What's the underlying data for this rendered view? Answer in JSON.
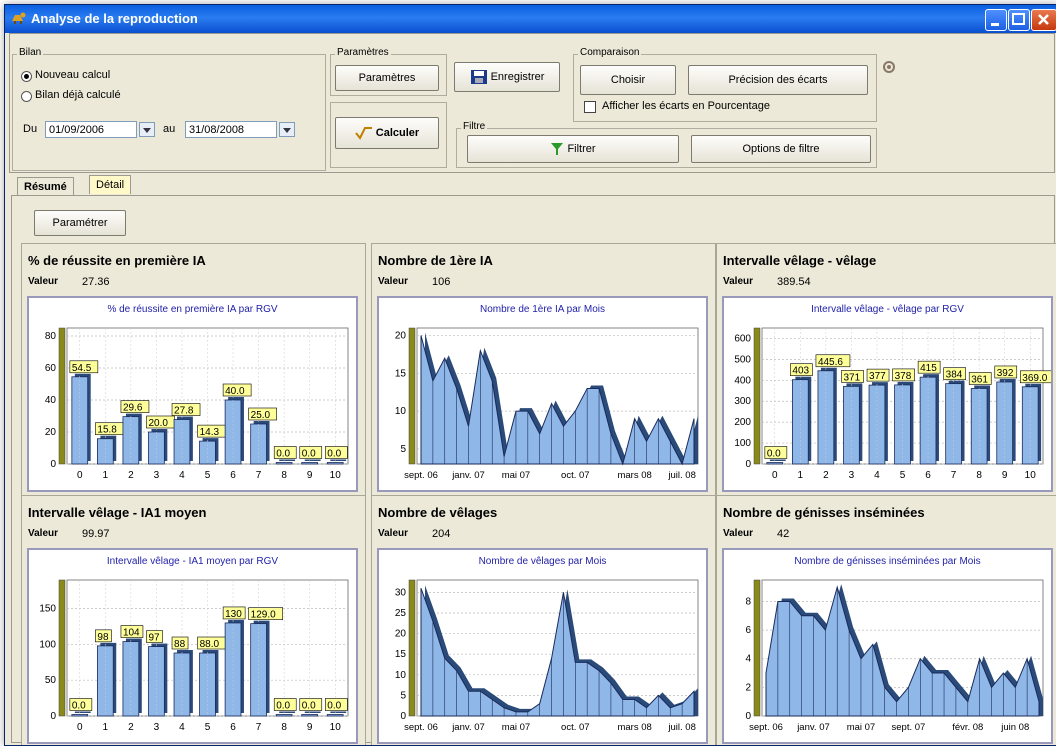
{
  "window": {
    "title": "Analyse de la reproduction"
  },
  "bilan": {
    "legend": "Bilan",
    "opt1": "Nouveau calcul",
    "opt2": "Bilan déjà calculé",
    "du_label": "Du",
    "du_value": "01/09/2006",
    "au_label": "au",
    "au_value": "31/08/2008"
  },
  "params": {
    "legend": "Paramètres",
    "button": "Paramètres"
  },
  "enregistrer": "Enregistrer",
  "calculer": "Calculer",
  "comparaison": {
    "legend": "Comparaison",
    "choisir": "Choisir",
    "precision": "Précision des écarts",
    "checkbox": "Afficher les écarts en Pourcentage"
  },
  "filtre": {
    "legend": "Filtre",
    "filtrer": "Filtrer",
    "options": "Options de filtre"
  },
  "tabs": [
    "Résumé",
    "Détail"
  ],
  "parametrer": "Paramétrer",
  "value_label": "Valeur",
  "cards": [
    {
      "title": "% de réussite en première IA",
      "value": "27.36"
    },
    {
      "title": "Nombre de 1ère IA",
      "value": "106"
    },
    {
      "title": "Intervalle vêlage - vêlage",
      "value": "389.54"
    },
    {
      "title": "Intervalle vêlage - IA1 moyen",
      "value": "99.97"
    },
    {
      "title": "Nombre de vêlages",
      "value": "204"
    },
    {
      "title": "Nombre de génisses inséminées",
      "value": "42"
    }
  ],
  "chart_data": [
    {
      "type": "bar",
      "title": "% de réussite en première IA par RGV",
      "categories": [
        "0",
        "1",
        "2",
        "3",
        "4",
        "5",
        "6",
        "7",
        "8",
        "9",
        "10"
      ],
      "values": [
        54.5,
        15.8,
        29.6,
        20.0,
        27.8,
        14.3,
        40.0,
        25.0,
        0.0,
        0.0,
        0.0
      ],
      "labels": [
        "54.5",
        "15.8",
        "29.6",
        "20.0",
        "27.8",
        "14.3",
        "40.0",
        "25.0",
        "0.0",
        "0.0",
        "0.0"
      ],
      "yticks": [
        "0",
        "20",
        "40",
        "60",
        "80"
      ],
      "ylim": [
        0,
        85
      ],
      "grid": true,
      "bar_color": "#8fb8e8"
    },
    {
      "type": "area",
      "title": "Nombre de 1ère IA par Mois",
      "x": [
        "sept. 06",
        "oct. 06",
        "nov. 06",
        "déc. 06",
        "janv. 07",
        "févr. 07",
        "mars 07",
        "avr. 07",
        "mai 07",
        "juin 07",
        "juil. 07",
        "août 07",
        "sept. 07",
        "oct. 07",
        "nov. 07",
        "déc. 07",
        "janv. 08",
        "févr. 08",
        "mars 08",
        "avr. 08",
        "mai 08",
        "juin 08",
        "juil. 08",
        "août 08"
      ],
      "values": [
        20,
        14,
        17,
        13,
        8,
        18,
        14,
        4,
        10,
        10,
        7,
        11,
        8,
        10,
        13,
        13,
        7,
        3,
        9,
        6,
        9,
        6,
        3,
        9
      ],
      "xticks": [
        "sept. 06",
        "janv. 07",
        "mai 07",
        "oct. 07",
        "mars 08",
        "juil. 08"
      ],
      "yticks": [
        "5",
        "10",
        "15",
        "20"
      ],
      "ylim": [
        3,
        21
      ],
      "grid": true
    },
    {
      "type": "bar",
      "title": "Intervalle vêlage - vêlage par RGV",
      "categories": [
        "0",
        "1",
        "2",
        "3",
        "4",
        "5",
        "6",
        "7",
        "8",
        "9",
        "10"
      ],
      "values": [
        0.0,
        403.0,
        445.6,
        371.0,
        377.0,
        378.0,
        415.0,
        384.0,
        361.0,
        392.0,
        369.0
      ],
      "labels": [
        "0.0",
        "403",
        "445.6",
        "371",
        "377",
        "378",
        "415",
        "384",
        "361",
        "392",
        "369.0"
      ],
      "yticks": [
        "0",
        "100",
        "200",
        "300",
        "400",
        "500",
        "600"
      ],
      "ylim": [
        0,
        650
      ],
      "grid": true,
      "bar_color": "#8fb8e8"
    },
    {
      "type": "bar",
      "title": "Intervalle vêlage - IA1 moyen par RGV",
      "categories": [
        "0",
        "1",
        "2",
        "3",
        "4",
        "5",
        "6",
        "7",
        "8",
        "9",
        "10"
      ],
      "values": [
        0.0,
        98.0,
        104.0,
        97.0,
        88.0,
        88.0,
        130.0,
        129.0,
        0.0,
        0.0,
        0.0
      ],
      "labels": [
        "0.0",
        "98",
        "104",
        "97",
        "88",
        "88.0",
        "130",
        "129.0",
        "0.0",
        "0.0",
        "0.0"
      ],
      "yticks": [
        "0",
        "50",
        "100",
        "150"
      ],
      "ylim": [
        0,
        190
      ],
      "grid": true,
      "bar_color": "#8fb8e8"
    },
    {
      "type": "area",
      "title": "Nombre de vêlages par Mois",
      "x": [
        "sept. 06",
        "oct. 06",
        "nov. 06",
        "déc. 06",
        "janv. 07",
        "févr. 07",
        "mars 07",
        "avr. 07",
        "mai 07",
        "juin 07",
        "juil. 07",
        "août 07",
        "sept. 07",
        "oct. 07",
        "nov. 07",
        "déc. 07",
        "janv. 08",
        "févr. 08",
        "mars 08",
        "avr. 08",
        "mai 08",
        "juin 08",
        "juil. 08",
        "août 08"
      ],
      "values": [
        31,
        23,
        14,
        11,
        6,
        6,
        4,
        2,
        1,
        1,
        3,
        14,
        30,
        13,
        13,
        11,
        8,
        4,
        4,
        2,
        5,
        2,
        3,
        6
      ],
      "xticks": [
        "sept. 06",
        "janv. 07",
        "mai 07",
        "oct. 07",
        "mars 08",
        "juil. 08"
      ],
      "yticks": [
        "0",
        "5",
        "10",
        "15",
        "20",
        "25",
        "30"
      ],
      "ylim": [
        0,
        33
      ],
      "grid": true
    },
    {
      "type": "area",
      "title": "Nombre de génisses inséminées par Mois",
      "x": [
        "sept. 06",
        "oct. 06",
        "nov. 06",
        "déc. 06",
        "janv. 07",
        "févr. 07",
        "mars 07",
        "avr. 07",
        "mai 07",
        "juin 07",
        "juil. 07",
        "août 07",
        "sept. 07",
        "oct. 07",
        "nov. 07",
        "déc. 07",
        "janv. 08",
        "févr. 08",
        "mars 08",
        "avr. 08",
        "mai 08",
        "juin 08",
        "juil. 08",
        "août 08"
      ],
      "values": [
        3,
        8,
        8,
        7,
        7,
        6,
        9,
        6,
        4,
        5,
        2,
        1,
        2,
        4,
        3,
        3,
        2,
        1,
        4,
        2,
        3,
        2,
        4,
        1
      ],
      "xticks": [
        "sept. 06",
        "janv. 07",
        "mai 07",
        "sept. 07",
        "févr. 08",
        "juin 08"
      ],
      "yticks": [
        "0",
        "2",
        "4",
        "6",
        "8"
      ],
      "ylim": [
        0,
        9.5
      ],
      "grid": true
    }
  ]
}
